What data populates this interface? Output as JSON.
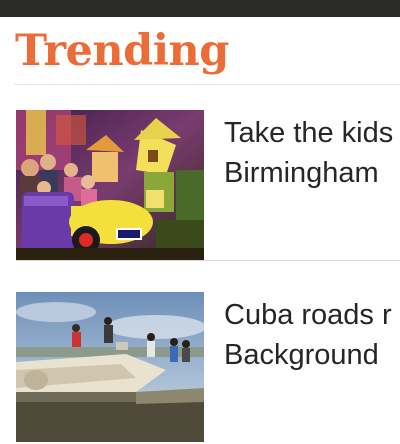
{
  "section": {
    "title": "Trending"
  },
  "articles": [
    {
      "headline": "Take the kids\nBirmingham",
      "image_icon": "theme-park-ride-photo"
    },
    {
      "headline": "Cuba roads r\nBackground",
      "image_icon": "cuba-wreck-photo"
    }
  ],
  "colors": {
    "accent": "#ec6c38",
    "top_bar": "#2b2b29",
    "headline": "#262626"
  }
}
